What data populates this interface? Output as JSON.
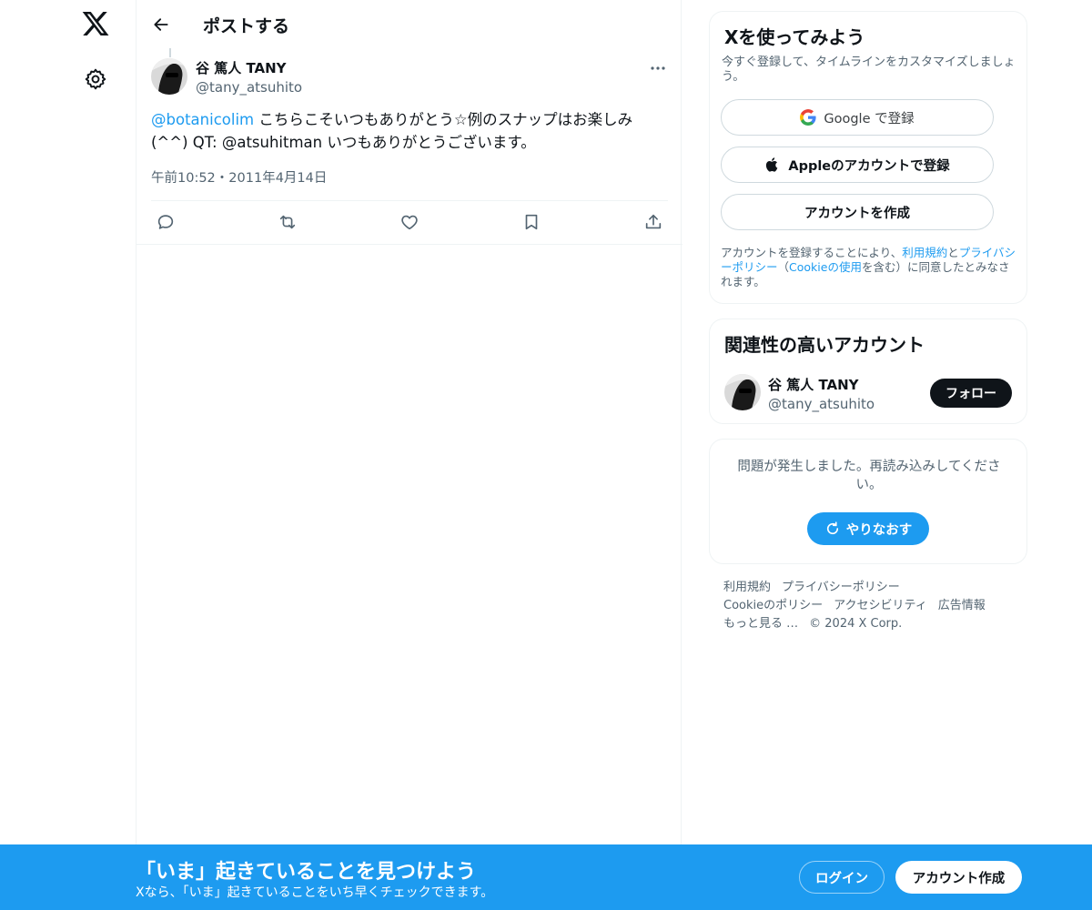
{
  "nav": {
    "logo_icon": "x-logo-icon",
    "settings_icon": "gear-icon"
  },
  "header": {
    "title": "ポストする",
    "back_icon": "arrow-left-icon"
  },
  "post": {
    "author_name": "谷 篤人 TANY",
    "author_handle": "@tany_atsuhito",
    "mention": "@botanicolim",
    "text_line1": " こちらこそいつもありがとう☆例のスナップはお楽しみ",
    "text_line2": "(^^) QT: @atsuhitman いつもありがとうございます。",
    "timestamp": "午前10:52・2011年4月14日",
    "more_icon": "more-horizontal-icon",
    "actions": [
      "reply-icon",
      "repost-icon",
      "like-icon",
      "bookmark-icon",
      "share-icon"
    ]
  },
  "signup": {
    "title": "Xを使ってみよう",
    "subtitle": "今すぐ登録して、タイムラインをカスタマイズしましょう。",
    "google_label": "Google で登録",
    "apple_label": "Appleのアカウントで登録",
    "create_label": "アカウントを作成",
    "legal_prefix": "アカウントを登録することにより、",
    "terms_link": "利用規約",
    "legal_and": "と",
    "privacy_link": "プライバシーポリシー",
    "legal_paren_open": "（",
    "cookie_link": "Cookieの使用",
    "legal_suffix": "を含む）に同意したとみなされます。"
  },
  "related": {
    "title": "関連性の高いアカウント",
    "name": "谷 篤人 TANY",
    "handle": "@tany_atsuhito",
    "follow_label": "フォロー"
  },
  "error": {
    "message": "問題が発生しました。再読み込みしてください。",
    "retry_label": "やりなおす"
  },
  "footer": {
    "terms": "利用規約",
    "privacy": "プライバシーポリシー",
    "cookie": "Cookieのポリシー",
    "accessibility": "アクセシビリティ",
    "ads": "広告情報",
    "more": "もっと見る …",
    "copyright": "© 2024 X Corp."
  },
  "banner": {
    "title": "「いま」起きていることを見つけよう",
    "subtitle": "Xなら、「いま」起きていることをいち早くチェックできます。",
    "login_label": "ログイン",
    "signup_label": "アカウント作成"
  },
  "colors": {
    "accent": "#1d9bf0",
    "text": "#0f1419",
    "secondary": "#536471",
    "border": "#eff3f4"
  }
}
